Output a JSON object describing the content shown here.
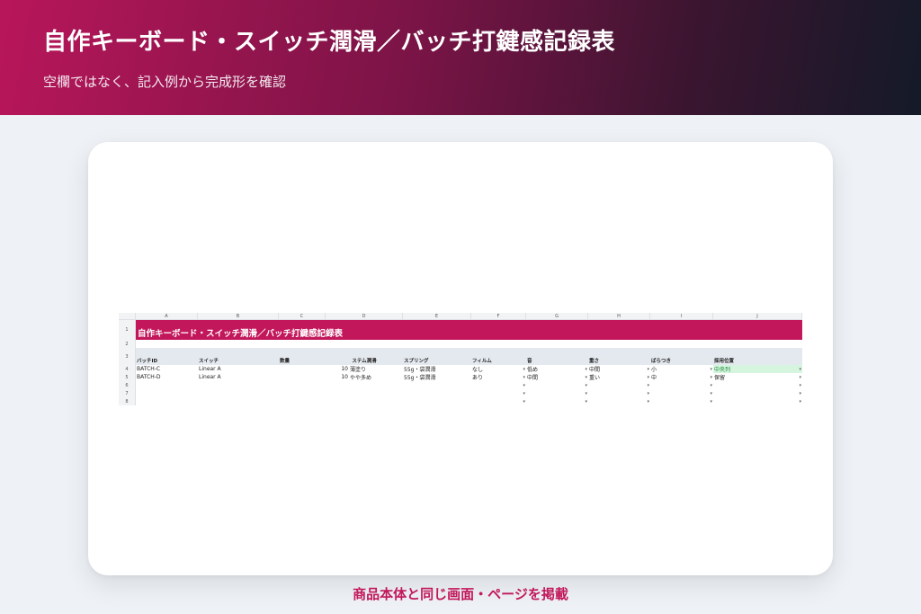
{
  "header": {
    "title": "自作キーボード・スイッチ潤滑／バッチ打鍵感記録表",
    "subtitle": "空欄ではなく、記入例から完成形を確認"
  },
  "sheet": {
    "columns": [
      "A",
      "B",
      "C",
      "D",
      "E",
      "F",
      "G",
      "H",
      "I",
      "J"
    ],
    "row_numbers": [
      "1",
      "2",
      "3",
      "4",
      "5",
      "6",
      "7",
      "8"
    ],
    "title": "自作キーボード・スイッチ潤滑／バッチ打鍵感記録表",
    "headers": [
      "バッチID",
      "スイッチ",
      "数量",
      "ステム潤滑",
      "スプリング",
      "フィルム",
      "音",
      "重さ",
      "ばらつき",
      "採用位置"
    ],
    "rows": [
      {
        "batch": "BATCH-C",
        "switch": "Linear A",
        "qty": "",
        "stem_qty": "10",
        "stem": "薄塗り",
        "spring": "55g・袋潤滑",
        "film": "なし",
        "sound": "低め",
        "weight": "中間",
        "variance": "小",
        "position": "中央列"
      },
      {
        "batch": "BATCH-D",
        "switch": "Linear A",
        "qty": "",
        "stem_qty": "10",
        "stem": "やや多め",
        "spring": "55g・袋潤滑",
        "film": "あり",
        "sound": "中間",
        "weight": "重い",
        "variance": "中",
        "position": "保留"
      }
    ],
    "highlight_color": "#d6f5df"
  },
  "footer": {
    "label": "商品本体と同じ画面・ページを掲載"
  }
}
